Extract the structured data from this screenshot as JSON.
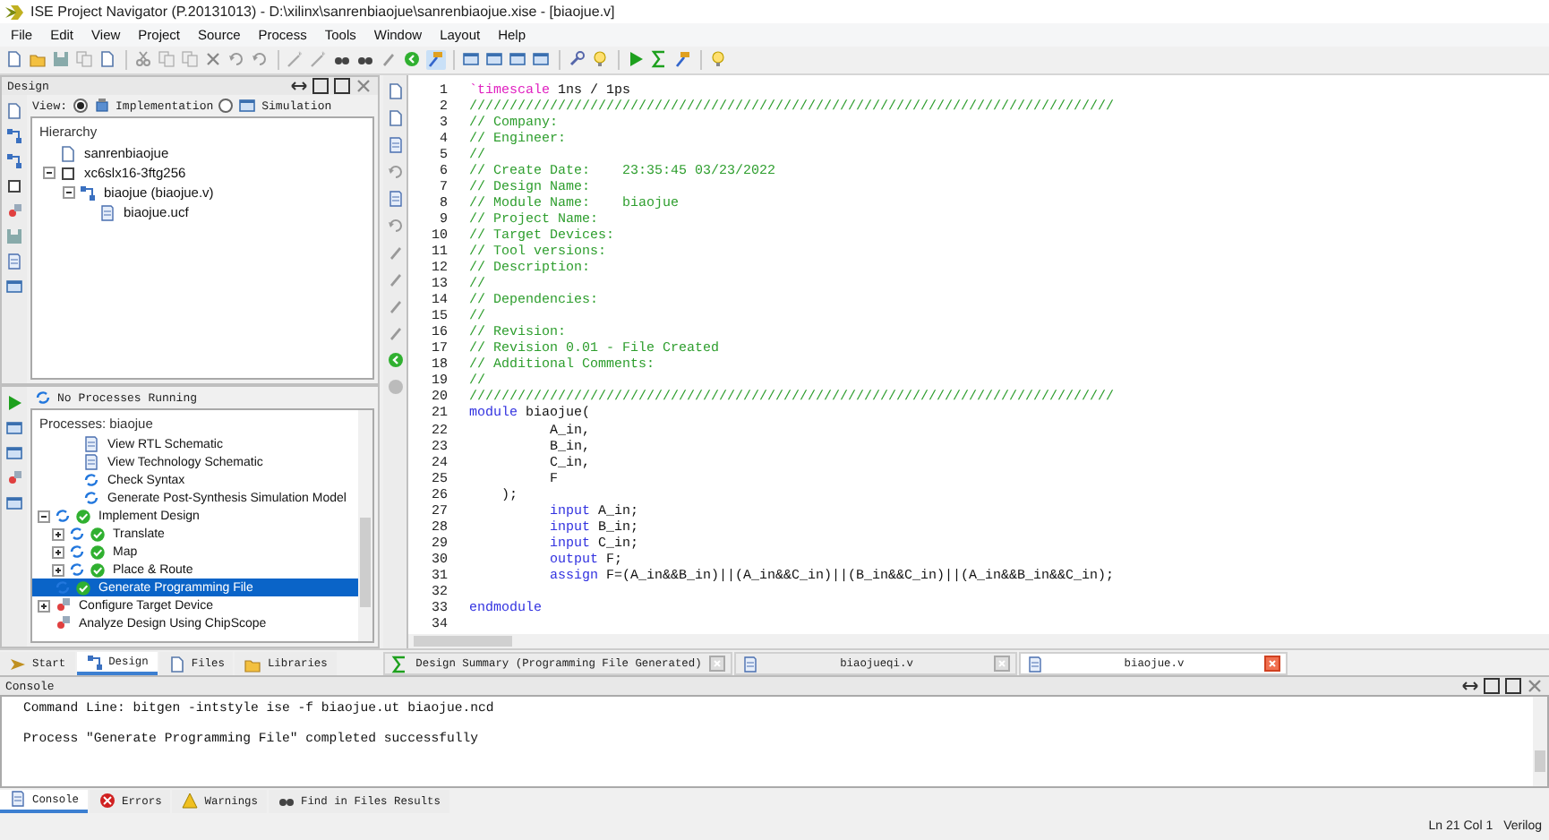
{
  "window": {
    "title": "ISE Project Navigator (P.20131013) - D:\\xilinx\\sanrenbiaojue\\sanrenbiaojue.xise - [biaojue.v]"
  },
  "menu": [
    "File",
    "Edit",
    "View",
    "Project",
    "Source",
    "Process",
    "Tools",
    "Window",
    "Layout",
    "Help"
  ],
  "design_panel": {
    "title": "Design",
    "view_label": "View:",
    "views": [
      {
        "label": "Implementation",
        "selected": true
      },
      {
        "label": "Simulation",
        "selected": false
      }
    ],
    "hierarchy_title": "Hierarchy",
    "hierarchy": [
      {
        "label": "sanrenbiaojue",
        "kind": "project"
      },
      {
        "label": "xc6slx16-3ftg256",
        "kind": "device",
        "expanded": true,
        "children": [
          {
            "label": "biaojue (biaojue.v)",
            "kind": "module",
            "expanded": true,
            "children": [
              {
                "label": "biaojue.ucf",
                "kind": "constraints"
              }
            ]
          }
        ]
      }
    ]
  },
  "process_status": "No Processes Running",
  "processes": {
    "title": "Processes: biaojue",
    "top_partial": [
      {
        "label": "View RTL Schematic",
        "kind": "view",
        "done": false,
        "selected": false
      },
      {
        "label": "View Technology Schematic",
        "kind": "view",
        "done": false,
        "selected": false
      },
      {
        "label": "Check Syntax",
        "kind": "run",
        "done": false,
        "selected": false
      },
      {
        "label": "Generate Post-Synthesis Simulation Model",
        "kind": "run",
        "done": false,
        "selected": false
      }
    ],
    "items": [
      {
        "label": "Implement Design",
        "kind": "run",
        "done": true,
        "selected": false,
        "expanded": true,
        "children": [
          {
            "label": "Translate",
            "kind": "run",
            "done": true,
            "selected": false,
            "expanded": false
          },
          {
            "label": "Map",
            "kind": "run",
            "done": true,
            "selected": false,
            "expanded": false
          },
          {
            "label": "Place & Route",
            "kind": "run",
            "done": true,
            "selected": false,
            "expanded": false
          }
        ]
      },
      {
        "label": "Generate Programming File",
        "kind": "run",
        "done": true,
        "selected": true
      },
      {
        "label": "Configure Target Device",
        "kind": "configure",
        "done": false,
        "selected": false,
        "expanded": false
      },
      {
        "label": "Analyze Design Using ChipScope",
        "kind": "analyze",
        "done": false,
        "selected": false
      }
    ]
  },
  "code": [
    {
      "number": "1",
      "segments": [
        {
          "kind": "directive",
          "text": "`timescale"
        },
        {
          "kind": "plain",
          "text": " 1ns / 1ps"
        }
      ]
    },
    {
      "number": "2",
      "segments": [
        {
          "kind": "comment",
          "text": "////////////////////////////////////////////////////////////////////////////////"
        }
      ]
    },
    {
      "number": "3",
      "segments": [
        {
          "kind": "comment",
          "text": "// Company:"
        }
      ]
    },
    {
      "number": "4",
      "segments": [
        {
          "kind": "comment",
          "text": "// Engineer:"
        }
      ]
    },
    {
      "number": "5",
      "segments": [
        {
          "kind": "comment",
          "text": "//"
        }
      ]
    },
    {
      "number": "6",
      "segments": [
        {
          "kind": "comment",
          "text": "// Create Date:    23:35:45 03/23/2022"
        }
      ]
    },
    {
      "number": "7",
      "segments": [
        {
          "kind": "comment",
          "text": "// Design Name:"
        }
      ]
    },
    {
      "number": "8",
      "segments": [
        {
          "kind": "comment",
          "text": "// Module Name:    biaojue"
        }
      ]
    },
    {
      "number": "9",
      "segments": [
        {
          "kind": "comment",
          "text": "// Project Name:"
        }
      ]
    },
    {
      "number": "10",
      "segments": [
        {
          "kind": "comment",
          "text": "// Target Devices:"
        }
      ]
    },
    {
      "number": "11",
      "segments": [
        {
          "kind": "comment",
          "text": "// Tool versions:"
        }
      ]
    },
    {
      "number": "12",
      "segments": [
        {
          "kind": "comment",
          "text": "// Description:"
        }
      ]
    },
    {
      "number": "13",
      "segments": [
        {
          "kind": "comment",
          "text": "//"
        }
      ]
    },
    {
      "number": "14",
      "segments": [
        {
          "kind": "comment",
          "text": "// Dependencies:"
        }
      ]
    },
    {
      "number": "15",
      "segments": [
        {
          "kind": "comment",
          "text": "//"
        }
      ]
    },
    {
      "number": "16",
      "segments": [
        {
          "kind": "comment",
          "text": "// Revision:"
        }
      ]
    },
    {
      "number": "17",
      "segments": [
        {
          "kind": "comment",
          "text": "// Revision 0.01 - File Created"
        }
      ]
    },
    {
      "number": "18",
      "segments": [
        {
          "kind": "comment",
          "text": "// Additional Comments:"
        }
      ]
    },
    {
      "number": "19",
      "segments": [
        {
          "kind": "comment",
          "text": "//"
        }
      ]
    },
    {
      "number": "20",
      "segments": [
        {
          "kind": "comment",
          "text": "////////////////////////////////////////////////////////////////////////////////"
        }
      ]
    },
    {
      "number": "21",
      "segments": [
        {
          "kind": "keyword",
          "text": "module"
        },
        {
          "kind": "plain",
          "text": " biaojue("
        }
      ]
    },
    {
      "number": "22",
      "segments": [
        {
          "kind": "plain",
          "text": "          A_in,"
        }
      ]
    },
    {
      "number": "23",
      "segments": [
        {
          "kind": "plain",
          "text": "          B_in,"
        }
      ]
    },
    {
      "number": "24",
      "segments": [
        {
          "kind": "plain",
          "text": "          C_in,"
        }
      ]
    },
    {
      "number": "25",
      "segments": [
        {
          "kind": "plain",
          "text": "          F"
        }
      ]
    },
    {
      "number": "26",
      "segments": [
        {
          "kind": "plain",
          "text": "    );"
        }
      ]
    },
    {
      "number": "27",
      "segments": [
        {
          "kind": "keyword",
          "text": "          input"
        },
        {
          "kind": "plain",
          "text": " A_in;"
        }
      ]
    },
    {
      "number": "28",
      "segments": [
        {
          "kind": "keyword",
          "text": "          input"
        },
        {
          "kind": "plain",
          "text": " B_in;"
        }
      ]
    },
    {
      "number": "29",
      "segments": [
        {
          "kind": "keyword",
          "text": "          input"
        },
        {
          "kind": "plain",
          "text": " C_in;"
        }
      ]
    },
    {
      "number": "30",
      "segments": [
        {
          "kind": "keyword",
          "text": "          output"
        },
        {
          "kind": "plain",
          "text": " F;"
        }
      ]
    },
    {
      "number": "31",
      "segments": [
        {
          "kind": "keyword",
          "text": "          assign"
        },
        {
          "kind": "plain",
          "text": " F=(A_in&&B_in)||(A_in&&C_in)||(B_in&&C_in)||(A_in&&B_in&&C_in);"
        }
      ]
    },
    {
      "number": "32"
    },
    {
      "number": "33",
      "segments": [
        {
          "kind": "keyword",
          "text": "endmodule"
        }
      ]
    },
    {
      "number": "34"
    }
  ],
  "left_tabs": [
    {
      "label": "Start",
      "kind": "start",
      "selected": false
    },
    {
      "label": "Design",
      "kind": "design",
      "selected": true
    },
    {
      "label": "Files",
      "kind": "files",
      "selected": false
    },
    {
      "label": "Libraries",
      "kind": "libraries",
      "selected": false
    }
  ],
  "editor_tabs": [
    {
      "label": "Design Summary (Programming File Generated)",
      "kind": "summary",
      "selected": false
    },
    {
      "label": "biaojueqi.v",
      "kind": "file",
      "selected": false
    },
    {
      "label": "biaojue.v",
      "kind": "file",
      "selected": true
    }
  ],
  "console": {
    "title": "Console",
    "lines": [
      "Command Line: bitgen -intstyle ise -f biaojue.ut biaojue.ncd",
      "Process \"Generate Programming File\" completed successfully"
    ]
  },
  "console_tabs": [
    {
      "label": "Console",
      "kind": "console",
      "selected": true
    },
    {
      "label": "Errors",
      "kind": "errors",
      "selected": false
    },
    {
      "label": "Warnings",
      "kind": "warnings",
      "selected": false
    },
    {
      "label": "Find in Files Results",
      "kind": "find",
      "selected": false
    }
  ],
  "status_bar": {
    "position": "Ln 21 Col 1",
    "language": "Verilog"
  }
}
